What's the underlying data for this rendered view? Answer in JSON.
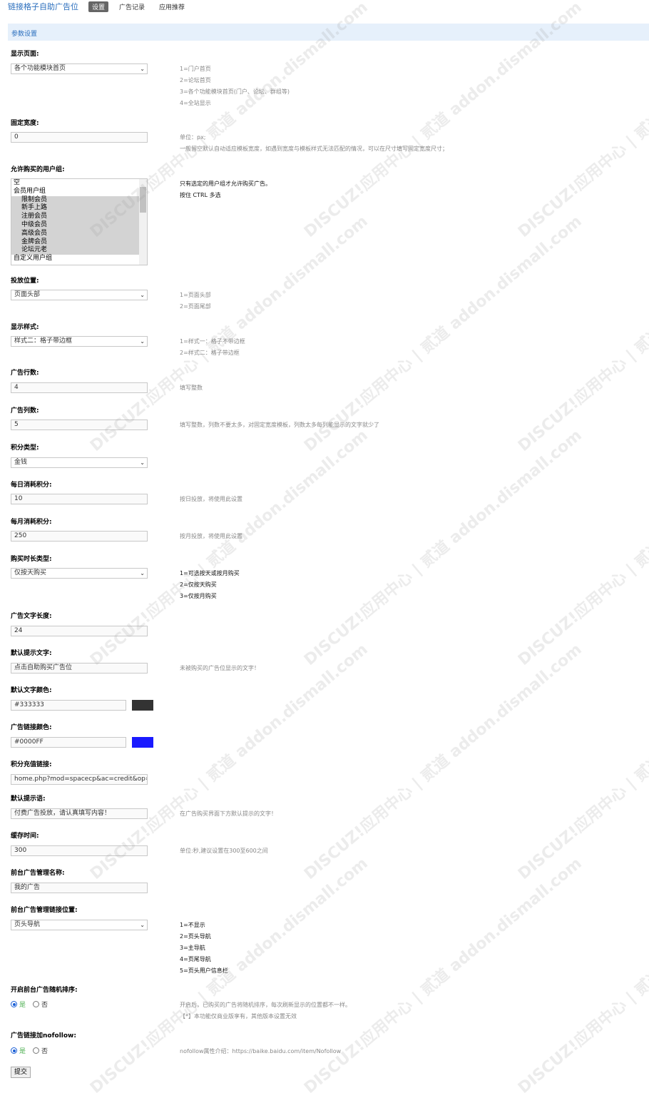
{
  "header": {
    "plugin_title": "链接格子自助广告位",
    "tabs": [
      {
        "label": "设置",
        "active": true
      },
      {
        "label": "广告记录",
        "active": false
      },
      {
        "label": "应用推荐",
        "active": false
      }
    ]
  },
  "section_title": "参数设置",
  "fields": {
    "display_page": {
      "label": "显示页面:",
      "value": "各个功能模块首页",
      "hints": [
        "1=门户首页",
        "2=论坛首页",
        "3=各个功能模块首页(门户、论坛、群组等)",
        "4=全站显示"
      ]
    },
    "fixed_width": {
      "label": "固定宽度:",
      "value": "0",
      "hints": [
        "单位：px;",
        "一般留空默认自动适应模板宽度，如遇到宽度与模板样式无法匹配的情况，可以在尺寸填写固定宽度尺寸；"
      ]
    },
    "user_groups": {
      "label": "允许购买的用户组:",
      "options": [
        "空",
        "会员用户组",
        "限制会员",
        "新手上路",
        "注册会员",
        "中级会员",
        "高级会员",
        "金牌会员",
        "论坛元老",
        "自定义用户组"
      ],
      "hints": [
        "只有选定的用户组才允许购买广告。",
        "按住 CTRL 多选"
      ]
    },
    "position": {
      "label": "投放位置:",
      "value": "页面头部",
      "hints": [
        "1=页面头部",
        "2=页面尾部"
      ]
    },
    "style": {
      "label": "显示样式:",
      "value": "样式二：格子带边框",
      "hints": [
        "1=样式一：格子不带边框",
        "2=样式二：格子带边框"
      ]
    },
    "rows": {
      "label": "广告行数:",
      "value": "4",
      "hint": "填写整数"
    },
    "cols": {
      "label": "广告列数:",
      "value": "5",
      "hint": "填写整数，列数不要太多，对固定宽度模板，列数太多每列能显示的文字就少了"
    },
    "credit_type": {
      "label": "积分类型:",
      "value": "金钱"
    },
    "daily_cost": {
      "label": "每日消耗积分:",
      "value": "10",
      "hint": "按日投放，将使用此设置"
    },
    "monthly_cost": {
      "label": "每月消耗积分:",
      "value": "250",
      "hint": "按月投放，将使用此设置"
    },
    "duration_type": {
      "label": "购买时长类型:",
      "value": "仅按天购买",
      "hints": [
        "1=可选按天或按月购买",
        "2=仅按天购买",
        "3=仅按月购买"
      ]
    },
    "text_length": {
      "label": "广告文字长度:",
      "value": "24"
    },
    "default_text": {
      "label": "默认提示文字:",
      "value": "点击自助购买广告位",
      "hint": "未被购买的广告位显示的文字！"
    },
    "default_color": {
      "label": "默认文字颜色:",
      "value": "#333333",
      "swatch": "#333333"
    },
    "link_color": {
      "label": "广告链接颜色:",
      "value": "#0000FF",
      "swatch": "#1a1aff"
    },
    "recharge_link": {
      "label": "积分充值链接:",
      "value": "home.php?mod=spacecp&ac=credit&op="
    },
    "default_tip": {
      "label": "默认提示语:",
      "value": "付费广告投放，请认真填写内容！",
      "hint": "在广告购买界面下方默认提示的文字！"
    },
    "cache_time": {
      "label": "缓存时间:",
      "value": "300",
      "hint": "单位:秒,建议设置在300至600之间"
    },
    "front_name": {
      "label": "前台广告管理名称:",
      "value": "我的广告"
    },
    "front_link_pos": {
      "label": "前台广告管理链接位置:",
      "value": "页头导航",
      "hints": [
        "1=不显示",
        "2=页头导航",
        "3=主导航",
        "4=页尾导航",
        "5=页头用户信息栏"
      ]
    },
    "random_sort": {
      "label": "开启前台广告随机排序:",
      "yes": "是",
      "no": "否",
      "hints": [
        "开启后，已购买的广告将随机排序，每次刷新显示的位置都不一样。",
        "【*】本功能仅商业版享有，其他版本设置无效"
      ]
    },
    "nofollow": {
      "label_prefix": "广告链接加",
      "label_bold": "nofollow",
      "label_suffix": ":",
      "yes": "是",
      "no": "否",
      "hint": "nofollow属性介绍：https://baike.baidu.com/item/Nofollow"
    }
  },
  "submit_label": "提交",
  "watermark": "DISCUZ!应用中心 | 贰道 addon.dismall.com"
}
